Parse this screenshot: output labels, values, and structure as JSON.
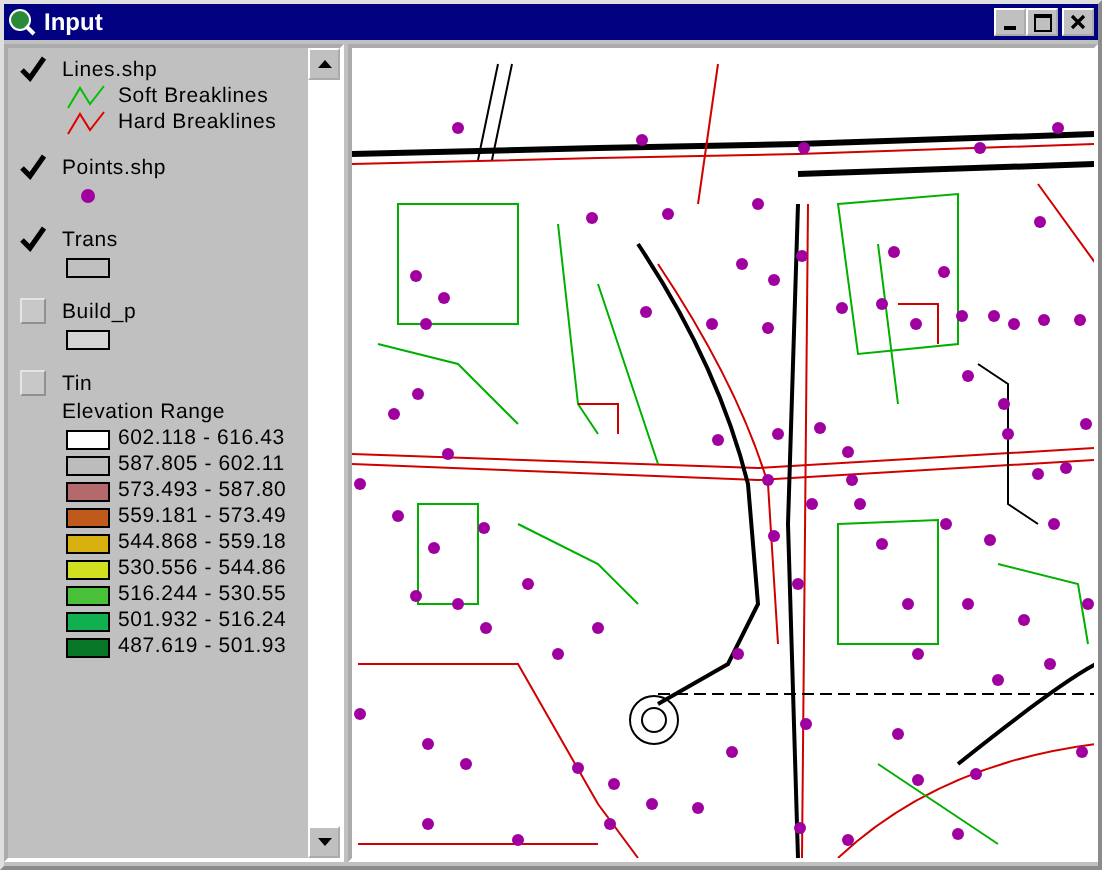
{
  "window": {
    "title": "Input"
  },
  "layers": [
    {
      "name": "Lines.shp",
      "checked": true,
      "legend": [
        {
          "kind": "line",
          "color": "#00c000",
          "label": "Soft Breaklines"
        },
        {
          "kind": "line",
          "color": "#e00000",
          "label": "Hard Breaklines"
        }
      ]
    },
    {
      "name": "Points.shp",
      "checked": true,
      "legend": [
        {
          "kind": "point",
          "color": "#a000a0"
        }
      ]
    },
    {
      "name": "Trans",
      "checked": true,
      "legend": [
        {
          "kind": "fill",
          "color": "#c0c0c0"
        }
      ]
    },
    {
      "name": "Build_p",
      "checked": false,
      "legend": [
        {
          "kind": "fill",
          "color": "#d4d4d4"
        }
      ]
    },
    {
      "name": "Tin",
      "checked": false,
      "legend": [
        {
          "kind": "heading",
          "label": "Elevation Range"
        },
        {
          "kind": "fill",
          "color": "#ffffff",
          "label": "602.118 - 616.43"
        },
        {
          "kind": "fill",
          "color": "#bcbcbc",
          "label": "587.805 - 602.11"
        },
        {
          "kind": "fill",
          "color": "#b46a6a",
          "label": "573.493 - 587.80"
        },
        {
          "kind": "fill",
          "color": "#c05a1c",
          "label": "559.181 - 573.49"
        },
        {
          "kind": "fill",
          "color": "#d8b010",
          "label": "544.868 - 559.18"
        },
        {
          "kind": "fill",
          "color": "#d0e020",
          "label": "530.556 - 544.86"
        },
        {
          "kind": "fill",
          "color": "#48c038",
          "label": "516.244 - 530.55"
        },
        {
          "kind": "fill",
          "color": "#10b050",
          "label": "501.932 - 516.24"
        },
        {
          "kind": "fill",
          "color": "#087828",
          "label": "487.619 - 501.93"
        }
      ]
    }
  ]
}
